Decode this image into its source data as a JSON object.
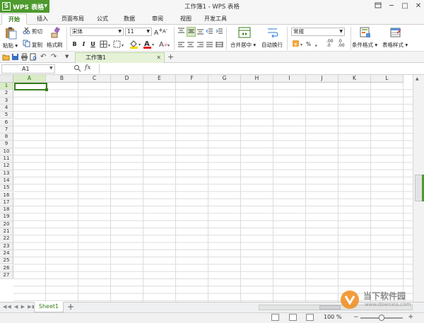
{
  "app": {
    "name": "WPS 表格",
    "logo_letter": "S",
    "window_title": "工作簿1 - WPS 表格"
  },
  "tabs": [
    "开始",
    "插入",
    "页面布局",
    "公式",
    "数据",
    "审阅",
    "视图",
    "开发工具"
  ],
  "ribbon": {
    "paste": "粘贴",
    "cut": "剪切",
    "copy": "复制",
    "format_painter": "格式刷",
    "font_name": "宋体",
    "font_size": "11",
    "merge_center": "合并居中",
    "wrap_text": "自动换行",
    "number_format": "常规",
    "percent": "%",
    "thousands": ",",
    "conditional_format": "条件格式",
    "table_style": "表格样式",
    "bold": "B",
    "italic": "I",
    "underline": "U",
    "font_color_letter": "A",
    "inc_font": "A",
    "dec_font": "A",
    "inc_decimal": ".00",
    "dec_decimal": ".0"
  },
  "document_tab": "工作簿1",
  "formula_bar": {
    "name_box": "A1",
    "fx_label": "fx",
    "value": ""
  },
  "columns": [
    "A",
    "B",
    "C",
    "D",
    "E",
    "F",
    "G",
    "H",
    "I",
    "J",
    "K",
    "L"
  ],
  "rows": [
    "1",
    "2",
    "3",
    "4",
    "5",
    "6",
    "7",
    "8",
    "9",
    "10",
    "11",
    "12",
    "13",
    "14",
    "15",
    "16",
    "17",
    "18",
    "19",
    "20",
    "21",
    "22",
    "23",
    "24",
    "25",
    "26",
    "27"
  ],
  "active_cell": "A1",
  "sheets": [
    "Sheet1"
  ],
  "status": {
    "zoom": "100 %",
    "zoom_fraction": 0.5
  },
  "watermark": {
    "name": "当下软件园",
    "url": "www.downxia.com"
  },
  "colors": {
    "accent": "#4e9a2e",
    "accent_dark": "#3a7e1d",
    "selected_header": "#d9ecc5"
  }
}
